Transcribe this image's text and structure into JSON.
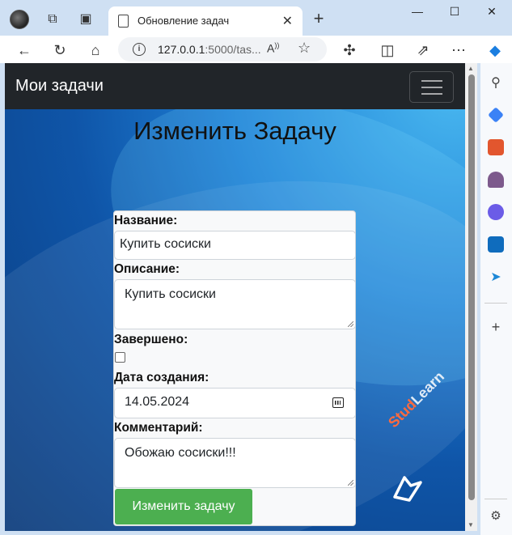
{
  "browser": {
    "tab_title": "Обновление задач",
    "url_host": "127.0.0.1",
    "url_rest": ":5000/tas...",
    "new_tab_label": "+",
    "close_tab_label": "✕"
  },
  "app": {
    "brand": "Мои задачи",
    "heading": "Изменить Задачу"
  },
  "form": {
    "title_label": "Название:",
    "title_value": "Купить сосиски",
    "description_label": "Описание:",
    "description_value": "Купить сосиски",
    "completed_label": "Завершено:",
    "completed": false,
    "created_label": "Дата создания:",
    "created_value": "14.05.2024",
    "comment_label": "Комментарий:",
    "comment_value": "Обожаю сосиски!!!",
    "submit_label": "Изменить задачу"
  },
  "watermark": {
    "part1": "Stud",
    "part2": "Learn"
  },
  "colors": {
    "navbar_bg": "#212529",
    "submit_bg": "#4caf50",
    "watermark_accent": "#ff6a3d"
  }
}
